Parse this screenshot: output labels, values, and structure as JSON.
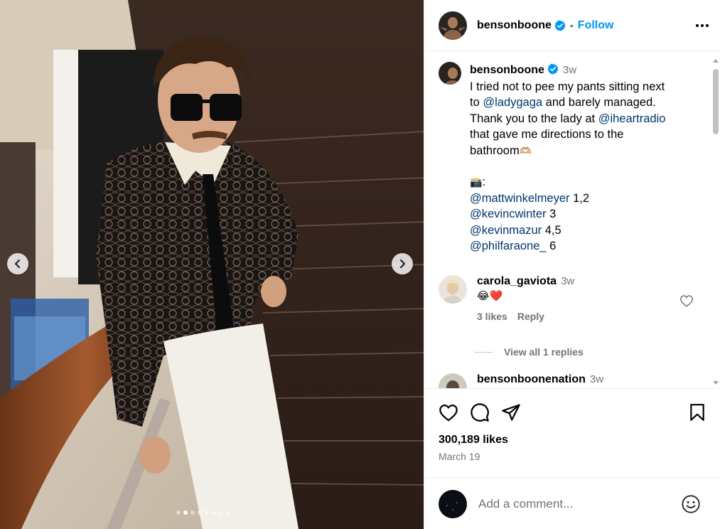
{
  "post": {
    "author": "bensonboone",
    "follow_label": "Follow",
    "separator": "•",
    "caption": {
      "time": "3w",
      "line1": "I tried not to pee my pants sitting next",
      "line2_pre": "to ",
      "line2_mention": "@ladygaga",
      "line2_post": " and barely managed.",
      "line3_pre": "Thank you to the lady at ",
      "line3_mention": "@iheartradio",
      "line4": "that gave me directions to the",
      "line5": "bathroom",
      "line5_emoji": "🫶🏼",
      "camera_emoji": "📸",
      "camera_colon": ":",
      "credits": [
        {
          "mention": "@mattwinkelmeyer",
          "nums": " 1,2"
        },
        {
          "mention": "@kevincwinter",
          "nums": " 3"
        },
        {
          "mention": "@kevinmazur",
          "nums": " 4,5"
        },
        {
          "mention": "@philfaraone_",
          "nums": " 6"
        }
      ]
    },
    "comments": [
      {
        "user": "carola_gaviota",
        "time": "3w",
        "text": "😂❤️",
        "likes": "3 likes",
        "reply": "Reply",
        "view_replies": "View all 1 replies"
      },
      {
        "user": "bensonboonenation",
        "time": "3w"
      }
    ],
    "likes": "300,189 likes",
    "date": "March 19",
    "add_comment_placeholder": "Add a comment..."
  },
  "carousel": {
    "slides": 8,
    "active_index": 1
  },
  "colors": {
    "accent": "#0095f6",
    "mention": "#00376b",
    "muted": "#737373"
  },
  "icons": [
    "verified-icon",
    "more-icon",
    "heart-icon",
    "comment-icon",
    "share-icon",
    "save-icon",
    "emoji-icon",
    "chevron-left-icon",
    "chevron-right-icon"
  ]
}
